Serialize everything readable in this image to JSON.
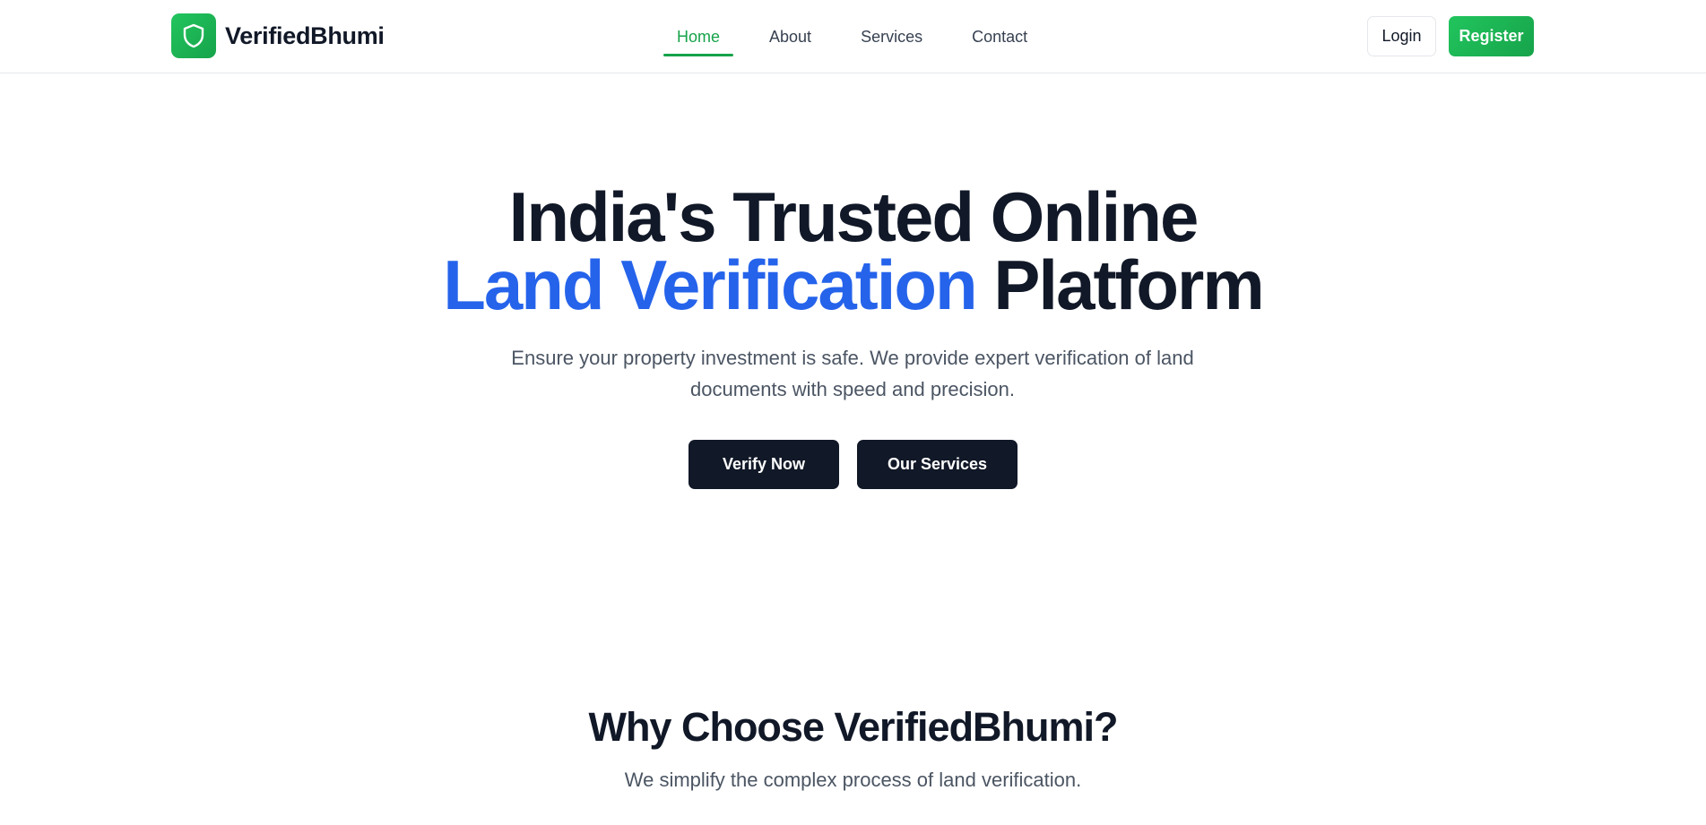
{
  "brand": {
    "name": "VerifiedBhumi",
    "logo_icon": "shield-icon",
    "accent_color": "#16a34a"
  },
  "nav": {
    "items": [
      {
        "label": "Home",
        "active": true
      },
      {
        "label": "About",
        "active": false
      },
      {
        "label": "Services",
        "active": false
      },
      {
        "label": "Contact",
        "active": false
      }
    ],
    "login_label": "Login",
    "register_label": "Register"
  },
  "hero": {
    "title_line1": "India's Trusted Online",
    "title_accent": "Land Verification",
    "title_rest": "Platform",
    "accent_color": "#2563eb",
    "subtitle": "Ensure your property investment is safe. We provide expert verification of land documents with speed and precision.",
    "primary_cta": "Verify Now",
    "secondary_cta": "Our Services"
  },
  "why": {
    "title": "Why Choose VerifiedBhumi?",
    "subtitle": "We simplify the complex process of land verification."
  }
}
